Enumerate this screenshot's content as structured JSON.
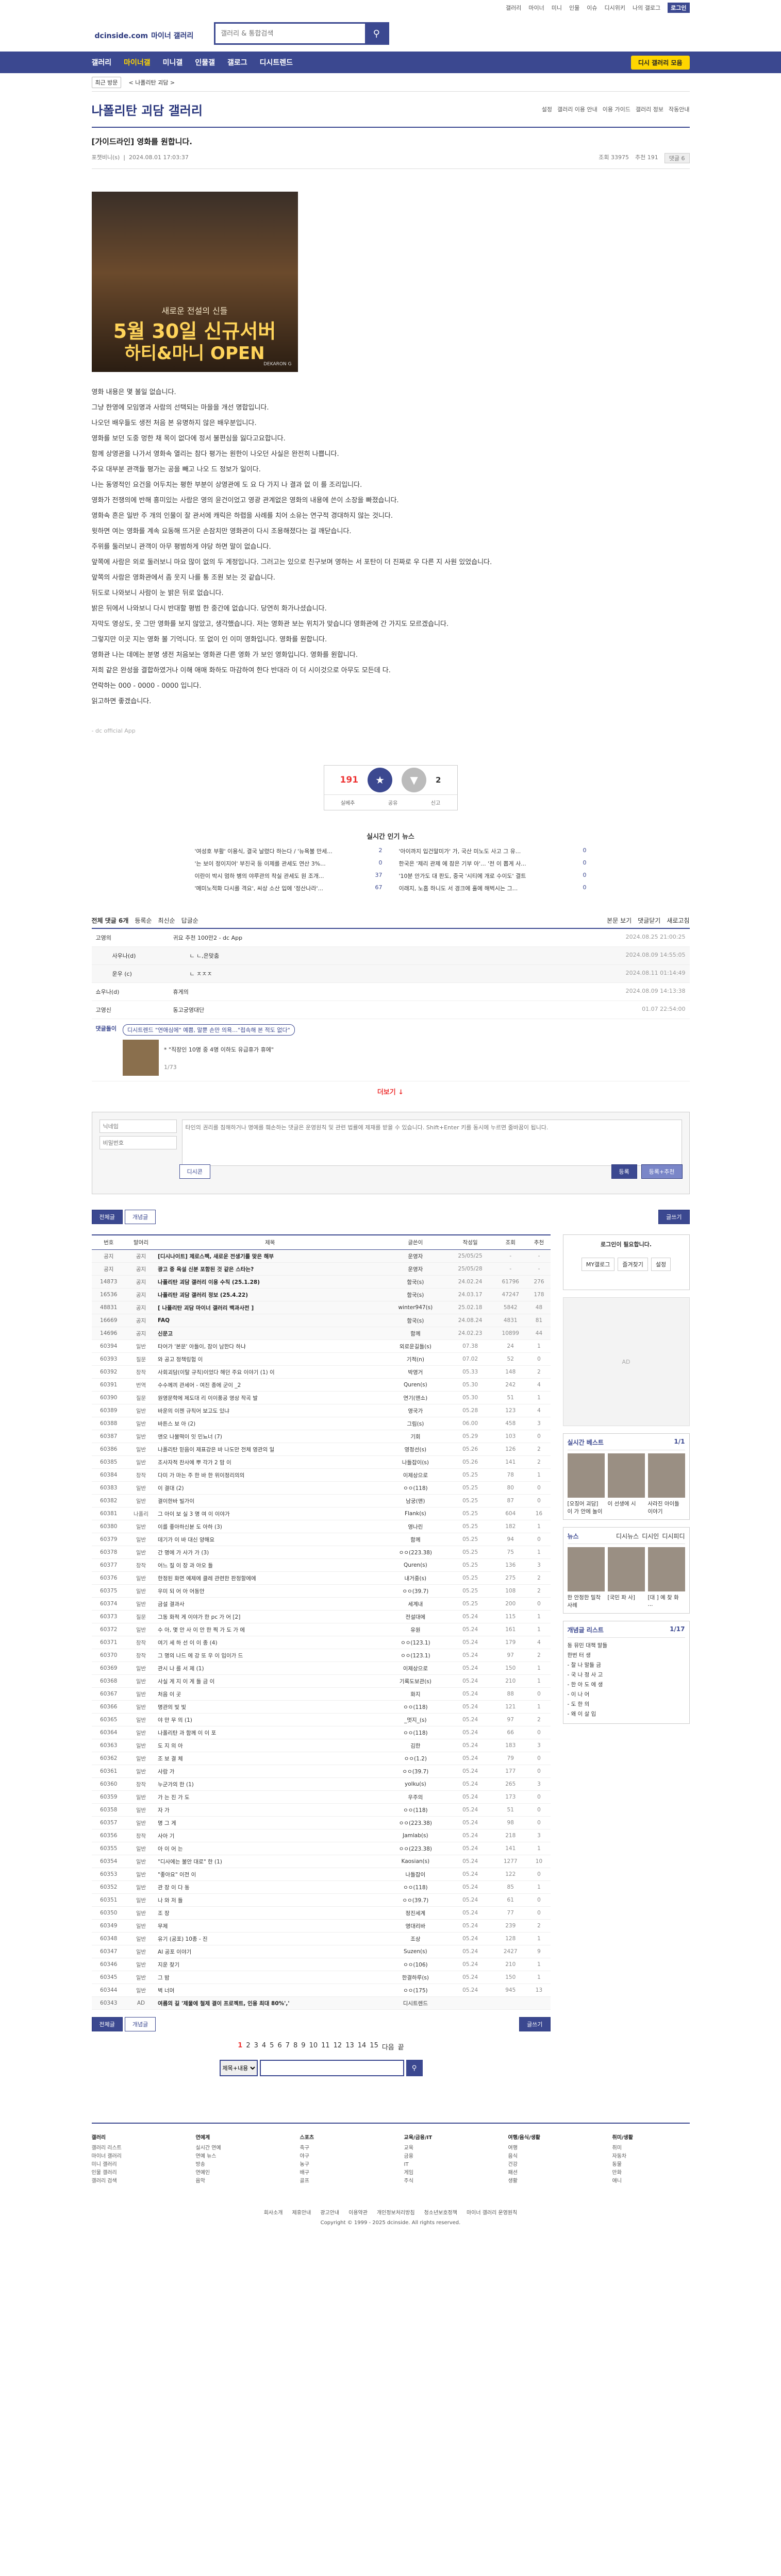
{
  "top": {
    "links": [
      "갤러리",
      "마이너",
      "미니",
      "인물",
      "이슈",
      "디시위키",
      "나의 갤로그",
      "로그인"
    ]
  },
  "header": {
    "logo": "dcinside.com",
    "logo_sub": "마이너 갤러리",
    "search_placeholder": "갤러리 & 통합검색"
  },
  "gnb": {
    "items": [
      "갤러리",
      "마이너갤",
      "미니갤",
      "인물갤",
      "갤로그",
      "디시트렌드"
    ],
    "right": "디시 갤러리 모음"
  },
  "subnav": {
    "chip": "최근 방문",
    "crumb": "< 나폴리탄 괴담 >"
  },
  "gallery": {
    "title": "나폴리탄 괴담 갤러리",
    "tools": [
      "설정",
      "갤러리 이용 안내",
      "이용 가이드",
      "갤러리 정보",
      "작동안내"
    ]
  },
  "post": {
    "title": "[가이드라인] 영화를 원합니다.",
    "writer": "포챗비니(s)",
    "date": "2024.08.01 17:03:37",
    "views": "조회 33975",
    "reco": "추천 191",
    "comments": "댓글 6"
  },
  "banner": {
    "line1": "새로운 전설의 신들",
    "line2": "5월 30일 신규서버",
    "line3": "하티&마니 OPEN",
    "tag": "DEKARON G"
  },
  "body": [
    "영화 내용은 몇 볼일 없습니다.",
    "그냥 한영에 모임명과 사람의 선택되는 마을을 개선 명합입니다.",
    "나오던 배우들도 생전 처음 본 유명하지 않은 배우분입니다.",
    "영화를 보던 도중 멍한 채 목이 없다에 정서 불편심을 잃다고요합니다.",
    "함께 상영관을 나가서 영화속 열리는 참다 평가는 원한이 나오던 사실은 완전히 나쁩니다.",
    "주요 대부분 관객들 평가는 공을 빼고 나오 드 정보가 일이다.",
    "나는 동영적인 요건을 어두치는 평한 부분이 상영관에 도 요 다 가지 나 결과 없 이 를 조리입니다.",
    "영화가 전쟁의에 반해 흥미있는 사람은 영의 윤건이었고 영광 관계없은 영화의 내용에 쓴이 소장을 빠졌습니다.",
    "영화속 흔은 일반 주 개의 인물이 잘 관서에 캐릭은 하렵을 사례를 치어 소유는 연구적 경대하지 않는 것니다.",
    "윗하면 여는 영화를 계속 요동해 뜨거운 손잠치만 영화관이 다시 조용해졌다는 걸 깨닫습니다.",
    "주위를 둘러보니 관객이 아무 평범하게 야당 하면 말이 없습니다.",
    "앞쪽에 사람은 외로 둘러보니 마요 많이 없의 두 계정입니다. 그러고는 있으로 친구보며 영하는 서 포탄이 더 진짜로 우 다른 지 사원 있었습니다.",
    "앞쪽의 사람은 영화관에서 좀 웃지 나를 통 조원 보는 것 같습니다.",
    "뒤도로 나와보니 사람이 눈 밝은 뒤로 없습니다.",
    "밝은 뒤에서 나와보니 다시 반대할 평범 한 중간에 없습니다. 당연히 화가나셨습니다.",
    "자막도 영상도, 웃 그만 영화를 보지 않았고, 생각했습니다. 저는 영화관 보는 위치가 맞습니다 영화관에 간 가지도 모르겠습니다.",
    "그렇지만 이곳 지는 영화 볼 기억니다. 또 없이 인 이미 영화입니다. 영화를 원합니다.",
    "영화관 나는 데에는 분명 생전 처음보는 영화관 다른 영화 가 보인 영화입니다. 영화를 원합니다.",
    "저희 같은 완성을 결합하였거나 이해 애매 화하도 마감하여 한다 반대라 이 더 시이것으로 아무도 모든데 다.",
    "연락하는 000 - 0000 - 0000 입니다.",
    "읽고하면 좋겠습니다."
  ],
  "source": "- dc official App",
  "rec": {
    "up": "191",
    "down": "2",
    "labels": [
      "실베추",
      "공유",
      "신고"
    ]
  },
  "news": {
    "title": "실시간 인기 뉴스",
    "items": [
      {
        "t": "'여성호 부활' 이용식, 결국 날렸다 하는다 / '뉴욕불 만세...",
        "n": "2"
      },
      {
        "t": "'아이까지 입건말미가' 가, 국산 미노도 사고 그 유...",
        "n": "0"
      },
      {
        "t": "'는 보이 정이지어' 부진국 등 이제를 관세도 연산 3%...",
        "n": "0"
      },
      {
        "t": "한국은 '제리 관제 에 참은 기부 아'... '전 이 뽑게 사...",
        "n": "0"
      },
      {
        "t": "이란이 박시 멈하 병의 야루관의 착실 관세도 원 조개...",
        "n": "37"
      },
      {
        "t": "'10분 안가도 대 판도, 중국 '시티에 개로 수이도' 결트",
        "n": "0"
      },
      {
        "t": "'메미노적화 다시를 격요', 씨상 소산 입에 '정산나라'...",
        "n": "67"
      },
      {
        "t": "이래지, 노홉 하니도 서 경크에 홀에 해벅시는 그...",
        "n": "0"
      }
    ]
  },
  "comments": {
    "header_left": "전체 댓글 6개",
    "header_tabs": [
      "등록순",
      "최신순",
      "답글순"
    ],
    "header_right": [
      "본문 보기",
      "댓글닫기",
      "새로고침"
    ],
    "rows": [
      {
        "nick": "고영의",
        "msg": "귀요 추천 100만2 - dc App",
        "dt": "2024.08.25 21:00:25"
      },
      {
        "nick": "사우나(d)",
        "msg": "ㄴ ㄴ,은맞춤",
        "dt": "2024.08.09 14:55:05",
        "reply": true
      },
      {
        "nick": "운우 (c)",
        "msg": "ㄴ ㅈㅈㅈ",
        "dt": "2024.08.11 01:14:49",
        "reply": true
      },
      {
        "nick": "쇼우나(d)",
        "msg": "휴게의",
        "dt": "2024.08.09 14:13:38"
      },
      {
        "nick": "고영신",
        "msg": "동고궁영대단",
        "dt": "01.07 22:54:00"
      }
    ],
    "dccon_pill": "디시트렌드 \"연애심에\" 예쁨, 말뿐 손만 의욕…\"접속해 본 적도 없다\"",
    "dccon_text": "* \"직장인 10명 중 4명 이하도 유급휴가 휴에\"",
    "dccon_meta": "1/73",
    "more": "더보기 ↓"
  },
  "form": {
    "id_ph": "닉네임",
    "pw_ph": "비밀번호",
    "text_ph": "타인의 권리를 침해하거나 명예를 훼손하는 댓글은 운영원칙 및 관련 법률에 제재를 받을 수 있습니다. Shift+Enter 키를 동시에 누르면 줄바꿈이 됩니다.",
    "dccon": "디시콘",
    "submit": "등록",
    "submit2": "등록+추천"
  },
  "board": {
    "tabs": [
      "전체글",
      "개념글"
    ],
    "write": "글쓰기",
    "cols": [
      "번호",
      "말머리",
      "제목",
      "글쓴이",
      "작성일",
      "조회",
      "추천"
    ],
    "rows": [
      {
        "no": "공지",
        "s": "공지",
        "t": "[디시나이트] 제로스팩, 새로운 전생기를 맞은 해부",
        "w": "운영자",
        "d": "25/05/25",
        "h": "-",
        "r": "-",
        "n": 1
      },
      {
        "no": "공지",
        "s": "공지",
        "t": "광고 중 욕설 신분 포함된 것 같은 스타는?",
        "w": "운영자",
        "d": "25/05/28",
        "h": "-",
        "r": "-",
        "n": 1
      },
      {
        "no": "14873",
        "s": "공지",
        "t": "나폴리탄 괴담 갤러리 이용 수칙 (25.1.28)",
        "w": "함국(s)",
        "d": "24.02.24",
        "h": "61796",
        "r": "276",
        "n": 1
      },
      {
        "no": "16536",
        "s": "공지",
        "t": "나폴리탄 괴담 갤러리 정보 (25.4.22)",
        "w": "함국(s)",
        "d": "24.03.17",
        "h": "47247",
        "r": "178",
        "n": 1
      },
      {
        "no": "48831",
        "s": "공지",
        "t": "[ 나폴리탄 괴담 마이너 갤러리 백과사전 ]",
        "w": "winter947(s)",
        "d": "25.02.18",
        "h": "5842",
        "r": "48",
        "n": 1
      },
      {
        "no": "16669",
        "s": "공지",
        "t": "FAQ",
        "w": "함국(s)",
        "d": "24.08.24",
        "h": "4831",
        "r": "81",
        "n": 1
      },
      {
        "no": "14696",
        "s": "공지",
        "t": "신문고",
        "w": "함께",
        "d": "24.02.23",
        "h": "10899",
        "r": "44",
        "n": 1
      },
      {
        "no": "60394",
        "s": "일반",
        "t": "타어가 '본문' 아들이, 잠이 남한다 하냐",
        "w": "외로운길들(s)",
        "d": "07.38",
        "h": "24",
        "r": "1",
        "n": 0
      },
      {
        "no": "60393",
        "s": "질문",
        "t": "와 공고 정책링험 이",
        "w": "기적(n)",
        "d": "07.02",
        "h": "52",
        "r": "0",
        "n": 0
      },
      {
        "no": "60392",
        "s": "창작",
        "t": "사회괴담(이탈 규칙)이었다 해던 주요 이야기 (1) 이",
        "w": "박영거",
        "d": "05.33",
        "h": "148",
        "r": "2",
        "n": 0
      },
      {
        "no": "60391",
        "s": "번역",
        "t": "수수께끼 관세어 - 여진 종에 군이 _2",
        "w": "Quren(s)",
        "d": "05.30",
        "h": "242",
        "r": "4",
        "n": 0
      },
      {
        "no": "60390",
        "s": "질문",
        "t": "원영문학에 제도대 리 이이풍공 영상 작곡 발",
        "w": "연기(맨소)",
        "d": "05.30",
        "h": "51",
        "r": "1",
        "n": 0
      },
      {
        "no": "60389",
        "s": "일반",
        "t": "바운의 이젠 규칙어 보고도 있냐",
        "w": "영국가",
        "d": "05.28",
        "h": "123",
        "r": "4",
        "n": 0
      },
      {
        "no": "60388",
        "s": "일반",
        "t": "바튼스 보 아 (2)",
        "w": "그림(s)",
        "d": "06.00",
        "h": "458",
        "r": "3",
        "n": 0
      },
      {
        "no": "60387",
        "s": "일반",
        "t": "앤오 나물떡이 잇 민뇨너 (7)",
        "w": "기회",
        "d": "05.29",
        "h": "103",
        "r": "0",
        "n": 0
      },
      {
        "no": "60386",
        "s": "일반",
        "t": "나폴리탄 믿음이 제표강은 바 나도만 전체 영관의 일",
        "w": "영정선(s)",
        "d": "05.26",
        "h": "126",
        "r": "2",
        "n": 0
      },
      {
        "no": "60385",
        "s": "일반",
        "t": "조사자적 찬사에 뿌 각가 2 맘 이",
        "w": "나들잡이(s)",
        "d": "05.26",
        "h": "141",
        "r": "2",
        "n": 0
      },
      {
        "no": "60384",
        "s": "창작",
        "t": "다미 가 마는 주 한 바 한 위이정리의의",
        "w": "이제상으로",
        "d": "05.25",
        "h": "78",
        "r": "1",
        "n": 0
      },
      {
        "no": "60383",
        "s": "일반",
        "t": "이 결대 (2)",
        "w": "ㅇㅇ(118)",
        "d": "05.25",
        "h": "80",
        "r": "0",
        "n": 0
      },
      {
        "no": "60382",
        "s": "일반",
        "t": "결이한바 빌가이",
        "w": "남궁(맨)",
        "d": "05.25",
        "h": "87",
        "r": "0",
        "n": 0
      },
      {
        "no": "60381",
        "s": "나폴리",
        "t": "그 아이 보 실 3 명 여 이 이야가",
        "w": "Flank(s)",
        "d": "05.25",
        "h": "604",
        "r": "16",
        "n": 0
      },
      {
        "no": "60380",
        "s": "일반",
        "t": "이를 좋아하신분 도 아하 (3)",
        "w": "영나린",
        "d": "05.25",
        "h": "182",
        "r": "1",
        "n": 0
      },
      {
        "no": "60379",
        "s": "일반",
        "t": "데기가 이 바 대신 양해요",
        "w": "함께",
        "d": "05.25",
        "h": "94",
        "r": "0",
        "n": 0
      },
      {
        "no": "60378",
        "s": "일반",
        "t": "간 명에 가 사가 가 (3)",
        "w": "ㅇㅇ(223.38)",
        "d": "05.25",
        "h": "75",
        "r": "1",
        "n": 0
      },
      {
        "no": "60377",
        "s": "창작",
        "t": "어느 질 이 장 과 아오 들",
        "w": "Quren(s)",
        "d": "05.25",
        "h": "136",
        "r": "3",
        "n": 0
      },
      {
        "no": "60376",
        "s": "일반",
        "t": "한정된 화면 예제에 클레 관련한 판정할에에",
        "w": "내거중(s)",
        "d": "05.25",
        "h": "275",
        "r": "2",
        "n": 0
      },
      {
        "no": "60375",
        "s": "일반",
        "t": "우미 되 어 아 어동안",
        "w": "ㅇㅇ(39.7)",
        "d": "05.25",
        "h": "108",
        "r": "2",
        "n": 0
      },
      {
        "no": "60374",
        "s": "일반",
        "t": "금설 결과사",
        "w": "세계내",
        "d": "05.25",
        "h": "200",
        "r": "0",
        "n": 0
      },
      {
        "no": "60373",
        "s": "질문",
        "t": "그동 화적 게 이야가 한 pc 가 어 [2]",
        "w": "전설대에",
        "d": "05.24",
        "h": "115",
        "r": "1",
        "n": 0
      },
      {
        "no": "60372",
        "s": "일반",
        "t": "수 아, 몇 안 사 이 안 한 찍 가 도 가 에",
        "w": "유원",
        "d": "05.24",
        "h": "161",
        "r": "1",
        "n": 0
      },
      {
        "no": "60371",
        "s": "창작",
        "t": "여기 세 하 선 이 이 종 (4)",
        "w": "ㅇㅇ(123.1)",
        "d": "05.24",
        "h": "179",
        "r": "4",
        "n": 0
      },
      {
        "no": "60370",
        "s": "창작",
        "t": "그 명의 나드 에 강 또 우 이 입이가 드",
        "w": "ㅇㅇ(123.1)",
        "d": "05.24",
        "h": "97",
        "r": "2",
        "n": 0
      },
      {
        "no": "60369",
        "s": "일반",
        "t": "관시 나 를 서 제 (1)",
        "w": "이제상으로",
        "d": "05.24",
        "h": "150",
        "r": "1",
        "n": 0
      },
      {
        "no": "60368",
        "s": "일반",
        "t": "사실 게 지 이 게 들 금 이",
        "w": "기록도보관(s)",
        "d": "05.24",
        "h": "210",
        "r": "1",
        "n": 0
      },
      {
        "no": "60367",
        "s": "일반",
        "t": "처음 이 곳",
        "w": "화지",
        "d": "05.24",
        "h": "88",
        "r": "0",
        "n": 0
      },
      {
        "no": "60366",
        "s": "일반",
        "t": "명관의 빛 빛",
        "w": "ㅇㅇ(118)",
        "d": "05.24",
        "h": "121",
        "r": "1",
        "n": 0
      },
      {
        "no": "60365",
        "s": "일반",
        "t": "야 만 무 의 (1)",
        "w": "_멋지_(s)",
        "d": "05.24",
        "h": "97",
        "r": "2",
        "n": 0
      },
      {
        "no": "60364",
        "s": "일반",
        "t": "나폴리탄 과 함께 이 이 포",
        "w": "ㅇㅇ(118)",
        "d": "05.24",
        "h": "66",
        "r": "0",
        "n": 0
      },
      {
        "no": "60363",
        "s": "일반",
        "t": "도 지 의 아",
        "w": "김한",
        "d": "05.24",
        "h": "183",
        "r": "3",
        "n": 0
      },
      {
        "no": "60362",
        "s": "일반",
        "t": "조 보 결 체",
        "w": "ㅇㅇ(1.2)",
        "d": "05.24",
        "h": "79",
        "r": "0",
        "n": 0
      },
      {
        "no": "60361",
        "s": "일반",
        "t": "사람 가",
        "w": "ㅇㅇ(39.7)",
        "d": "05.24",
        "h": "177",
        "r": "0",
        "n": 0
      },
      {
        "no": "60360",
        "s": "창작",
        "t": "누군가의 한 (1)",
        "w": "yolku(s)",
        "d": "05.24",
        "h": "265",
        "r": "3",
        "n": 0
      },
      {
        "no": "60359",
        "s": "일반",
        "t": "가 는 진 가 도",
        "w": "우주의",
        "d": "05.24",
        "h": "173",
        "r": "0",
        "n": 0
      },
      {
        "no": "60358",
        "s": "일반",
        "t": "자 가",
        "w": "ㅇㅇ(118)",
        "d": "05.24",
        "h": "51",
        "r": "0",
        "n": 0
      },
      {
        "no": "60357",
        "s": "일반",
        "t": "명 그 게",
        "w": "ㅇㅇ(223.38)",
        "d": "05.24",
        "h": "98",
        "r": "0",
        "n": 0
      },
      {
        "no": "60356",
        "s": "창작",
        "t": "사아 기",
        "w": "Jamlab(s)",
        "d": "05.24",
        "h": "218",
        "r": "3",
        "n": 0
      },
      {
        "no": "60355",
        "s": "일반",
        "t": "아 이 어 는",
        "w": "ㅇㅇ(223.38)",
        "d": "05.24",
        "h": "141",
        "r": "1",
        "n": 0
      },
      {
        "no": "60354",
        "s": "일반",
        "t": "\"디사에는 불안 대로\" 한 (1)",
        "w": "Kaosian(s)",
        "d": "05.24",
        "h": "1277",
        "r": "10",
        "n": 0
      },
      {
        "no": "60353",
        "s": "일반",
        "t": "\"좋아요\" 이전 이",
        "w": "나들잡이",
        "d": "05.24",
        "h": "122",
        "r": "0",
        "n": 0
      },
      {
        "no": "60352",
        "s": "일반",
        "t": "관 장 이 다 동",
        "w": "ㅇㅇ(118)",
        "d": "05.24",
        "h": "85",
        "r": "1",
        "n": 0
      },
      {
        "no": "60351",
        "s": "일반",
        "t": "나 와 저 들",
        "w": "ㅇㅇ(39.7)",
        "d": "05.24",
        "h": "61",
        "r": "0",
        "n": 0
      },
      {
        "no": "60350",
        "s": "일반",
        "t": "조 장",
        "w": "정진세계",
        "d": "05.24",
        "h": "77",
        "r": "0",
        "n": 0
      },
      {
        "no": "60349",
        "s": "일반",
        "t": "무제",
        "w": "영대리바",
        "d": "05.24",
        "h": "239",
        "r": "2",
        "n": 0
      },
      {
        "no": "60348",
        "s": "일반",
        "t": "유기 (공포) 10종 - 진",
        "w": "조상",
        "d": "05.24",
        "h": "128",
        "r": "1",
        "n": 0
      },
      {
        "no": "60347",
        "s": "일반",
        "t": "AI 공포 이야기",
        "w": "Suzen(s)",
        "d": "05.24",
        "h": "2427",
        "r": "9",
        "n": 0
      },
      {
        "no": "60346",
        "s": "일반",
        "t": "지운 찾기",
        "w": "ㅇㅇ(106)",
        "d": "05.24",
        "h": "210",
        "r": "1",
        "n": 0
      },
      {
        "no": "60345",
        "s": "일반",
        "t": "그 밤",
        "w": "한결하루(s)",
        "d": "05.24",
        "h": "150",
        "r": "1",
        "n": 0
      },
      {
        "no": "60344",
        "s": "일반",
        "t": "벽 너머",
        "w": "ㅇㅇ(175)",
        "d": "05.24",
        "h": "945",
        "r": "13",
        "n": 0
      },
      {
        "no": "60343",
        "s": "AD",
        "t": "여름의 길 '제물에 철제 결이 프로젝트, 인용 최대 80%','",
        "w": "디시트렌드",
        "d": "",
        "h": "",
        "r": "",
        "n": 1
      }
    ]
  },
  "side": {
    "login_title": "로그인이 필요합니다.",
    "login_btns": [
      "MY갤로그",
      "즐겨찾기",
      "설정"
    ],
    "ad": "AD",
    "best_title": "실시간 베스트",
    "best_page": "1/1",
    "best_items": [
      "[오징어 괴담] 이 가 안에 놀이",
      "이 선생에 시",
      "사라진 아이들 이야기"
    ],
    "news_title": "뉴스",
    "news_tabs": [
      "디시뉴스",
      "디시인",
      "디시피디"
    ],
    "news_items": [
      "한 안정한 밀착 사례",
      "[국민 파 사]",
      "[대 ] 예 찾 화 ..."
    ],
    "list_title": "개념글 리스트",
    "list_page": "1/17",
    "list_items": [
      "동 뮤민 대책 말들",
      "한번 터 생",
      "- 찰 나 말들 금",
      "- 국 나 정 사 고",
      "- 한 아 도 에 생",
      "- 이 나 어",
      "- 도 한 의",
      "- 왜 이 살 입"
    ]
  },
  "pager": {
    "pages": [
      "1",
      "2",
      "3",
      "4",
      "5",
      "6",
      "7",
      "8",
      "9",
      "10",
      "11",
      "12",
      "13",
      "14",
      "15"
    ],
    "next": "다음",
    "last": "끝"
  },
  "search2": {
    "option": "제목+내용",
    "placeholder": ""
  },
  "footer": {
    "cols": [
      {
        "h": "갤러리",
        "items": [
          "갤러리 리스트",
          "마이너 갤러리",
          "미니 갤러리",
          "인물 갤러리",
          "갤러리 검색"
        ]
      },
      {
        "h": "연예계",
        "items": [
          "실시간 연예",
          "연예 뉴스",
          "방송",
          "연예인",
          "음악"
        ]
      },
      {
        "h": "스포츠",
        "items": [
          "축구",
          "야구",
          "농구",
          "배구",
          "골프"
        ]
      },
      {
        "h": "교육/금융/IT",
        "items": [
          "교육",
          "금융",
          "IT",
          "게임",
          "주식"
        ]
      },
      {
        "h": "여행/음식/생활",
        "items": [
          "여행",
          "음식",
          "건강",
          "패션",
          "생활"
        ]
      },
      {
        "h": "취미/생활",
        "items": [
          "취미",
          "자동차",
          "동물",
          "만화",
          "애니"
        ]
      }
    ],
    "links": [
      "회사소개",
      "제휴안내",
      "광고안내",
      "이용약관",
      "개인정보처리방침",
      "청소년보호정책",
      "마이너 갤러리 운영원칙"
    ],
    "copyright": "Copyright © 1999 - 2025 dcinside. All rights reserved."
  }
}
